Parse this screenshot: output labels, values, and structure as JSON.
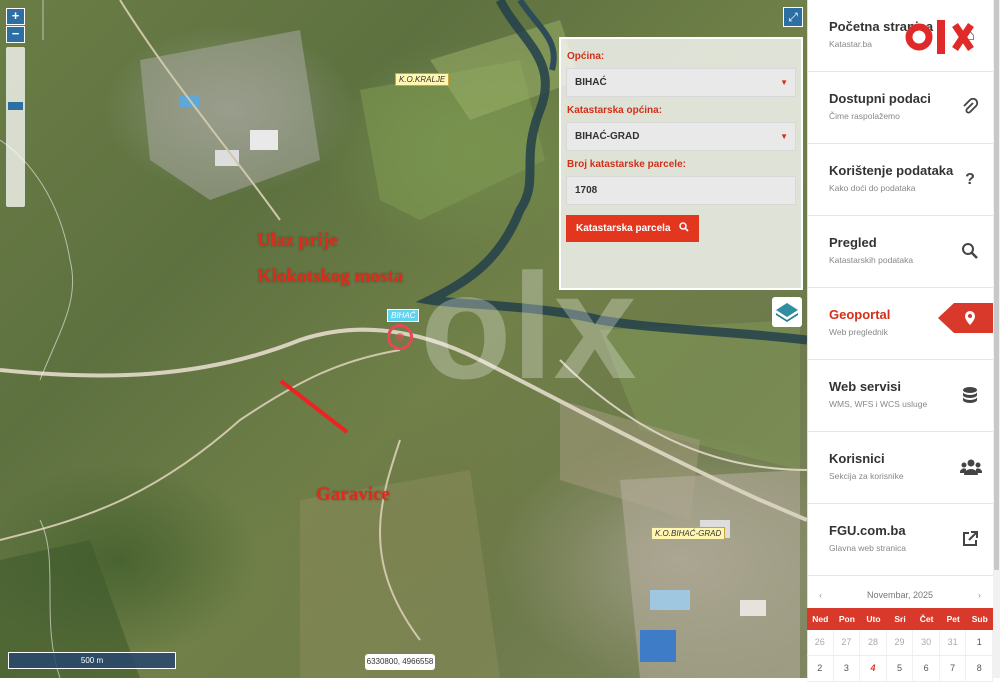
{
  "map": {
    "zoom_in": "+",
    "zoom_out": "−",
    "expand_icon": "expand-icon",
    "place_labels": [
      "K.O.KRALJE",
      "BIHAĆ",
      "K.O.BIHAĆ-GRAD"
    ],
    "overlay_text": {
      "line1": "Ulaz prije",
      "line2": "Klokotskog mosta",
      "area": "Garavice"
    },
    "watermark": "olx",
    "scale": "500 m",
    "coordinates": "6330800, 4966558"
  },
  "search_panel": {
    "opcina_label": "Općina:",
    "opcina_value": "BIHAĆ",
    "katastarska_label": "Katastarska općina:",
    "katastarska_value": "BIHAĆ-GRAD",
    "parcela_label": "Broj katastarske parcele:",
    "parcela_value": "1708",
    "button_label": "Katastarska parcela",
    "accent": "#e2361e"
  },
  "sidebar": {
    "logo": "olx",
    "items": [
      {
        "title": "Početna stranica",
        "subtitle": "Katastar.ba",
        "icon": "home-icon"
      },
      {
        "title": "Dostupni podaci",
        "subtitle": "Čime raspolažemo",
        "icon": "paperclip-icon"
      },
      {
        "title": "Korištenje podataka",
        "subtitle": "Kako doći do podataka",
        "icon": "question-icon"
      },
      {
        "title": "Pregled",
        "subtitle": "Katastarskih podataka",
        "icon": "search-icon"
      },
      {
        "title": "Geoportal",
        "subtitle": "Web preglednik",
        "icon": "map-marker-icon",
        "active": true
      },
      {
        "title": "Web servisi",
        "subtitle": "WMS, WFS i WCS usluge",
        "icon": "database-icon"
      },
      {
        "title": "Korisnici",
        "subtitle": "Sekcija za korisnike",
        "icon": "users-icon"
      },
      {
        "title": "FGU.com.ba",
        "subtitle": "Glavna web stranica",
        "icon": "external-link-icon"
      }
    ]
  },
  "calendar": {
    "month": "Novembar, 2025",
    "prev": "‹",
    "next": "›",
    "weekdays": [
      "Ned",
      "Pon",
      "Uto",
      "Sri",
      "Čet",
      "Pet",
      "Sub"
    ],
    "row1": [
      "26",
      "27",
      "28",
      "29",
      "30",
      "31",
      "1"
    ],
    "row2": [
      "2",
      "3",
      "4",
      "5",
      "6",
      "7",
      "8"
    ]
  }
}
